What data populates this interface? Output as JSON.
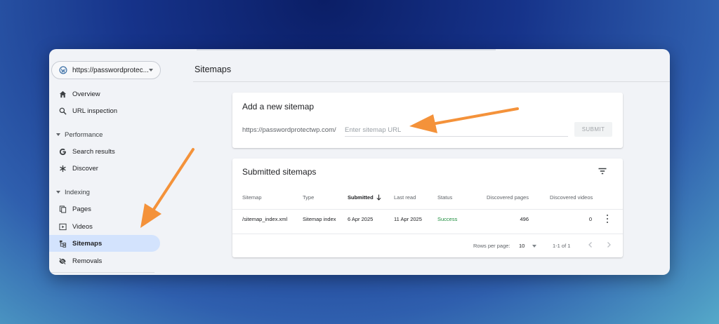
{
  "sidebar": {
    "property": "https://passwordprotec...",
    "items": [
      {
        "label": "Overview",
        "icon": "home-icon"
      },
      {
        "label": "URL inspection",
        "icon": "search-icon"
      }
    ],
    "sections": [
      {
        "label": "Performance",
        "items": [
          {
            "label": "Search results",
            "icon": "google-g-icon"
          },
          {
            "label": "Discover",
            "icon": "asterisk-icon"
          }
        ]
      },
      {
        "label": "Indexing",
        "items": [
          {
            "label": "Pages",
            "icon": "pages-icon"
          },
          {
            "label": "Videos",
            "icon": "video-icon"
          },
          {
            "label": "Sitemaps",
            "icon": "sitemap-icon",
            "active": true
          },
          {
            "label": "Removals",
            "icon": "eye-off-icon"
          }
        ]
      }
    ]
  },
  "main": {
    "title": "Sitemaps",
    "add_card": {
      "title": "Add a new sitemap",
      "url_prefix": "https://passwordprotectwp.com/",
      "input_placeholder": "Enter sitemap URL",
      "submit_label": "SUBMIT"
    },
    "submitted_card": {
      "title": "Submitted sitemaps",
      "columns": [
        "Sitemap",
        "Type",
        "Submitted",
        "Last read",
        "Status",
        "Discovered pages",
        "Discovered videos"
      ],
      "rows": [
        {
          "sitemap": "/sitemap_index.xml",
          "type": "Sitemap index",
          "submitted": "6 Apr 2025",
          "last_read": "11 Apr 2025",
          "status": "Success",
          "pages": "496",
          "videos": "0"
        }
      ],
      "rows_per_page_label": "Rows per page:",
      "rows_per_page_value": "10",
      "page_range": "1-1 of 1"
    }
  },
  "colors": {
    "accent_active_bg": "#d3e3fd",
    "success": "#1e8e3e",
    "annotation_arrow": "#f4923a"
  }
}
